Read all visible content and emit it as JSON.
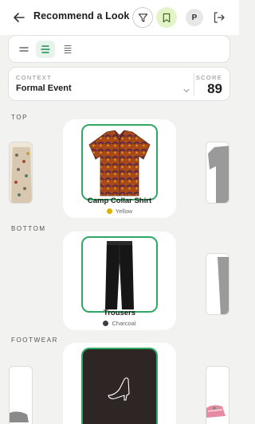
{
  "header": {
    "title": "Recommend a Look",
    "avatar_initial": "P"
  },
  "context": {
    "label": "CONTEXT",
    "value": "Formal Event",
    "score_label": "SCORE",
    "score": "89"
  },
  "sections": {
    "top": {
      "label": "TOP",
      "name": "Camp Collar Shirt",
      "color_name": "Yellow",
      "color_hex": "#e0b100"
    },
    "bottom": {
      "label": "BOTTOM",
      "name": "Trousers",
      "color_name": "Charcoal",
      "color_hex": "#3a3f45"
    },
    "footwear": {
      "label": "FOOTWEAR",
      "name": "",
      "color_name": "",
      "color_hex": "#2d2624"
    }
  },
  "colors": {
    "accent": "#2fa866",
    "bookmark_bg": "#e3f4c8"
  },
  "icons": [
    "arrow-left-icon",
    "filter-icon",
    "bookmark-icon",
    "logout-icon",
    "grid-list-icon",
    "center-list-icon",
    "compact-list-icon",
    "chevron-down-icon",
    "heel-icon"
  ]
}
